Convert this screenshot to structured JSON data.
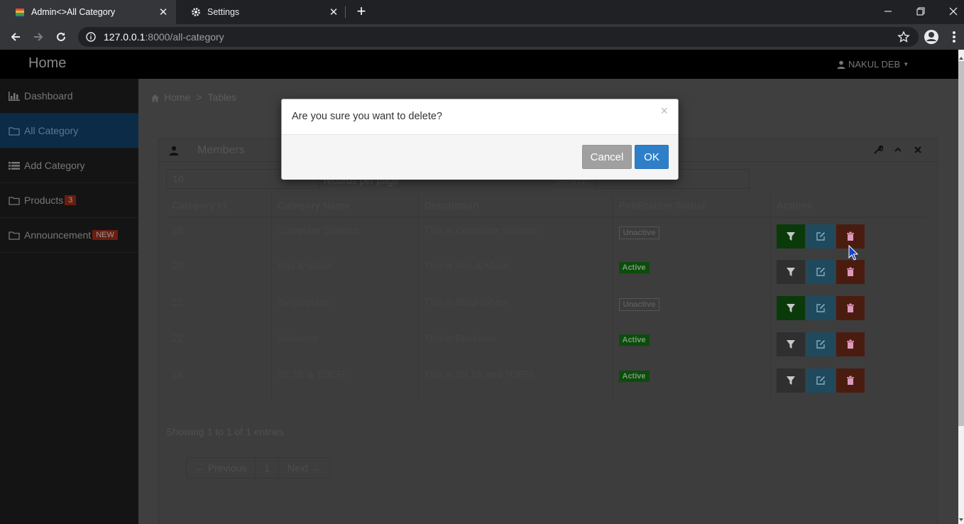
{
  "browser": {
    "tabs": [
      {
        "title": "Admin<>All Category",
        "active": true
      },
      {
        "title": "Settings",
        "active": false
      }
    ],
    "url": {
      "host": "127.0.0.1",
      "rest": ":8000/all-category"
    }
  },
  "header": {
    "brand": "Home",
    "user": "NAKUL DEB"
  },
  "sidebar": {
    "items": [
      {
        "label": "Dashboard",
        "icon": "bar-chart-icon"
      },
      {
        "label": "All Category",
        "icon": "folder-icon",
        "active": true
      },
      {
        "label": "Add Category",
        "icon": "list-icon"
      },
      {
        "label": "Products",
        "icon": "folder-icon",
        "badge": "3"
      },
      {
        "label": "Announcement",
        "icon": "folder-icon",
        "badge": "NEW"
      }
    ]
  },
  "breadcrumb": {
    "home": "Home",
    "sep": ">",
    "current": "Tables"
  },
  "box": {
    "title": "Members",
    "length_value": "10",
    "length_label": "records per page",
    "search_label": "Search:",
    "columns": [
      "Category Id",
      "Category Name",
      "Description",
      "Publication Status",
      "Actions"
    ],
    "rows": [
      {
        "id": "19",
        "name": "Computer Science",
        "desc": "This is Computer Science",
        "status": "Unactive"
      },
      {
        "id": "20",
        "name": "Arts & Music",
        "desc": "This is Arts & Music",
        "status": "Active"
      },
      {
        "id": "21",
        "name": "Biographies",
        "desc": "This is Biographies",
        "status": "Unactive"
      },
      {
        "id": "22",
        "name": "Business",
        "desc": "This is Business",
        "status": "Active"
      },
      {
        "id": "14",
        "name": "IELTS & TOEFL",
        "desc": "This is IELTS and TOEFL",
        "status": "Active"
      }
    ],
    "showing": "Showing 1 to 1 of 1 entries",
    "pager": {
      "prev": "← Previous",
      "page": "1",
      "next": "Next →"
    }
  },
  "modal": {
    "message": "Are you sure you want to delete?",
    "close": "×",
    "cancel": "Cancel",
    "ok": "OK"
  },
  "colors": {
    "accent": "#2f7fc8",
    "danger": "#4a1c10",
    "success": "#0a3a0a"
  }
}
